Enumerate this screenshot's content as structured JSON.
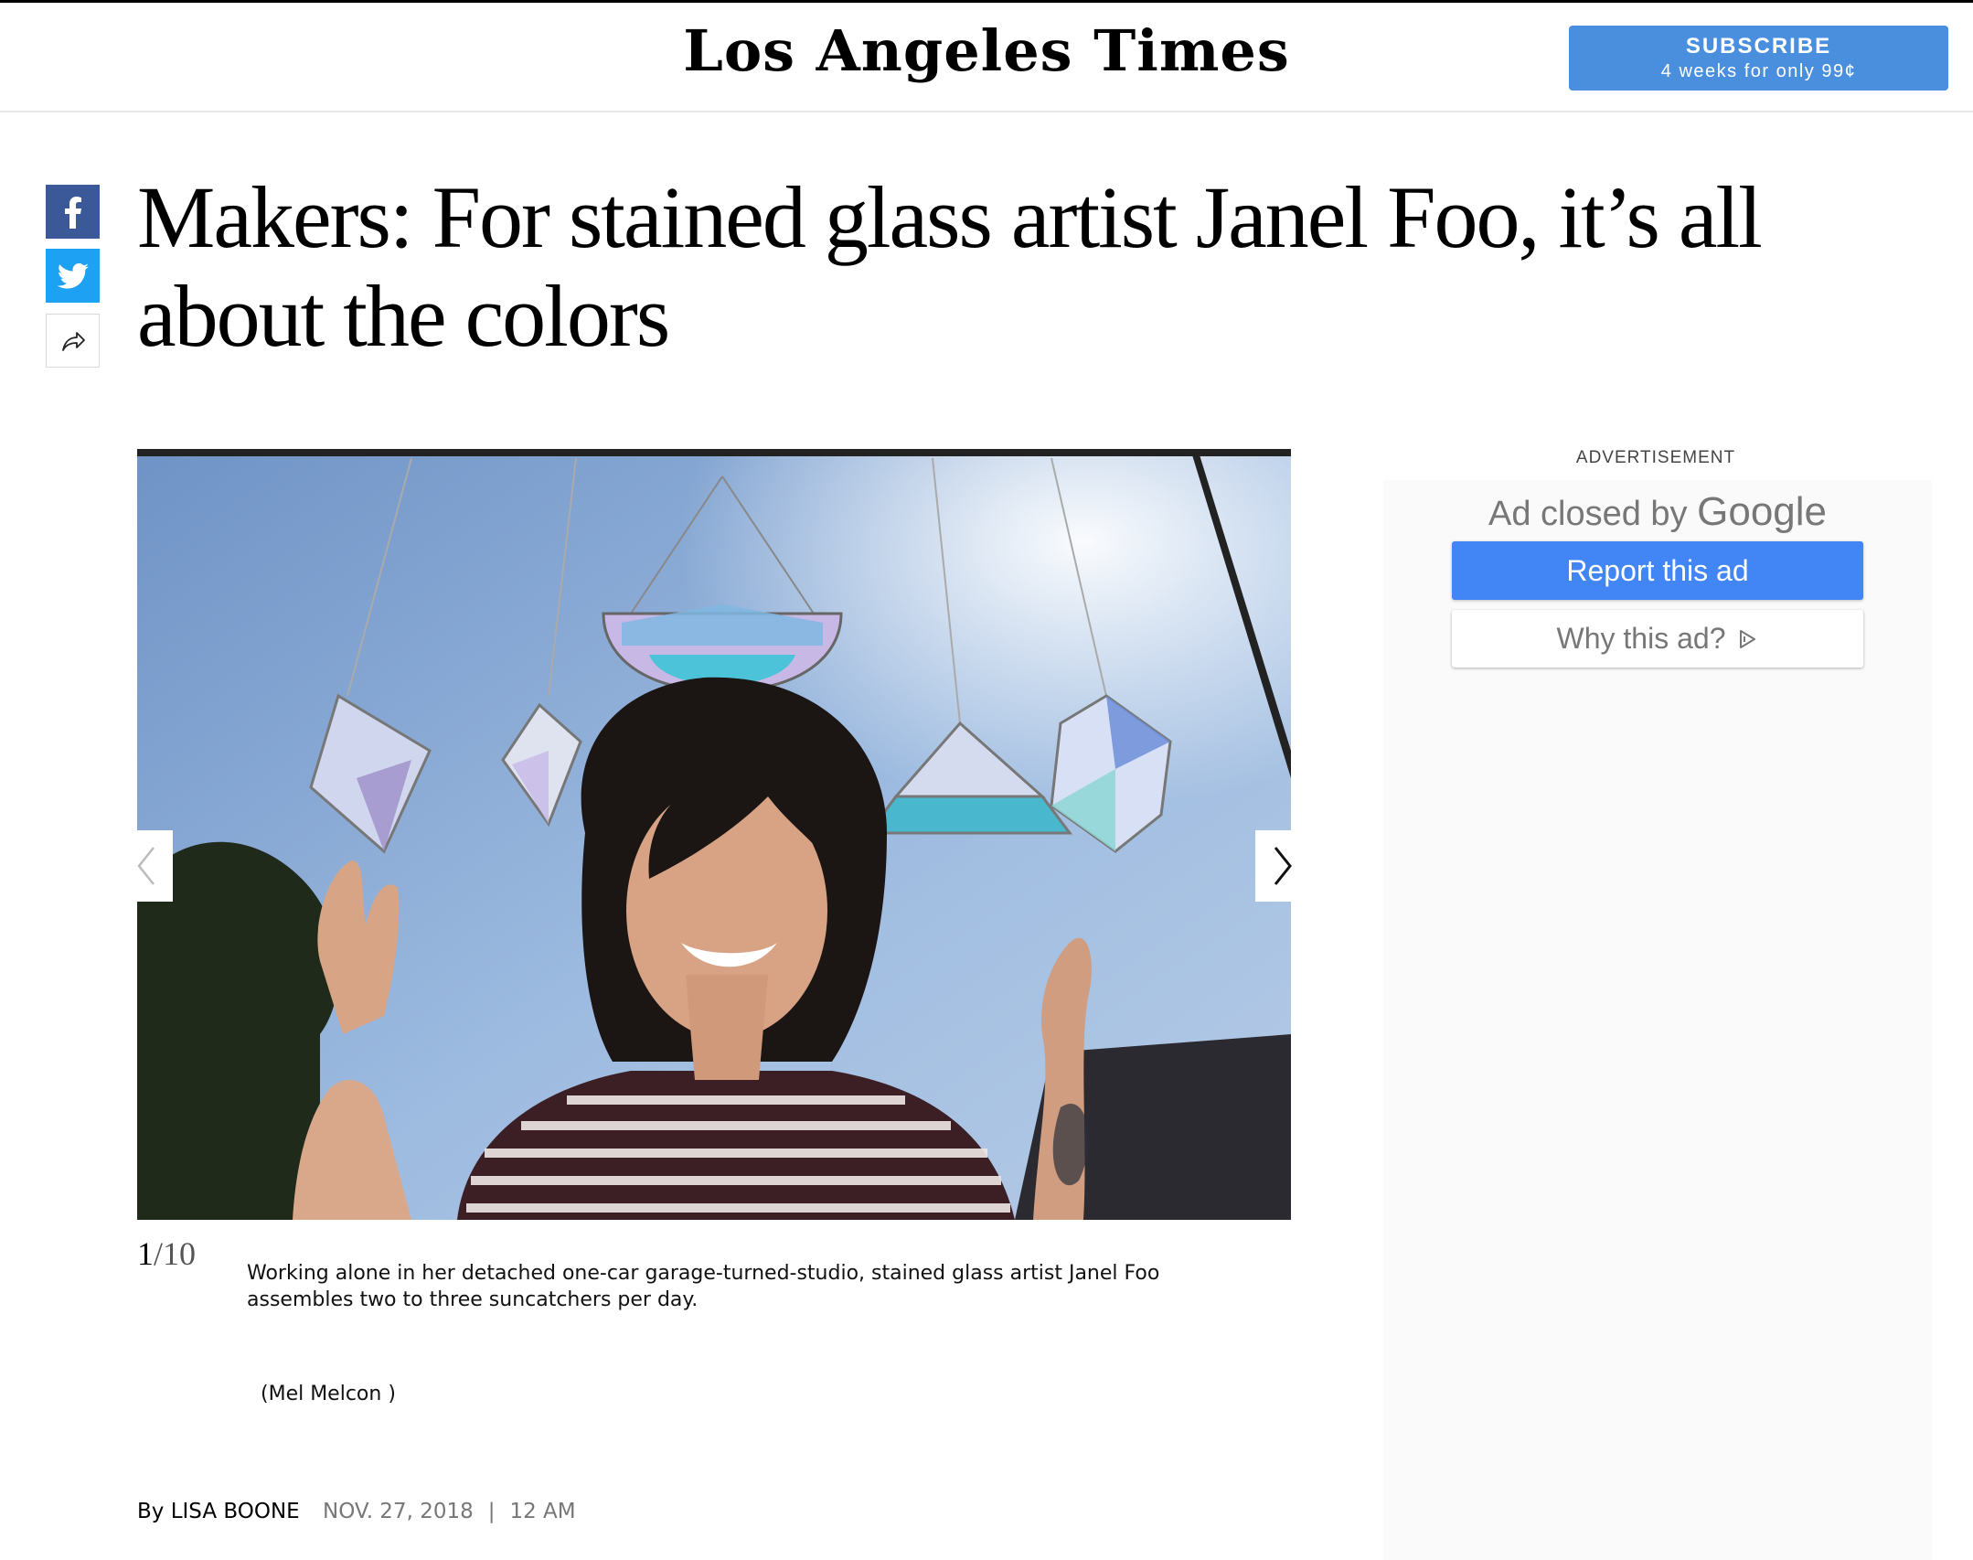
{
  "masthead": {
    "logo": "Los Angeles Times",
    "subscribe_title": "SUBSCRIBE",
    "subscribe_offer": "4 weeks for only 99¢"
  },
  "share": {
    "facebook_icon": "facebook-icon",
    "twitter_icon": "twitter-icon",
    "share_icon": "share-arrow-icon"
  },
  "article": {
    "headline": "Makers: For stained glass artist Janel Foo, it’s all about the colors",
    "byline_prefix": "By",
    "author": "LISA BOONE",
    "date": "NOV. 27, 2018",
    "separator": "|",
    "time": "12 AM"
  },
  "gallery": {
    "current": "1",
    "total": "/10",
    "caption": "Working alone in her detached one-car garage-turned-studio, stained glass artist Janel Foo assembles two to three suncatchers per day.",
    "credit": "(Mel Melcon )",
    "prev_icon": "chevron-left-icon",
    "next_icon": "chevron-right-icon"
  },
  "ad": {
    "label": "ADVERTISEMENT",
    "closed_text": "Ad closed by",
    "closed_brand": "Google",
    "report_label": "Report this ad",
    "why_label": "Why this ad?",
    "why_icon": "adchoices-icon",
    "report_color": "#4285f4"
  },
  "colors": {
    "subscribe_bg": "#4a8fde",
    "facebook": "#3b5998",
    "twitter": "#1da1f2"
  }
}
